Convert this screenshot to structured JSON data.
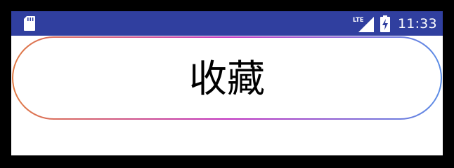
{
  "status_bar": {
    "background": "#303F9F",
    "network_label": "LTE",
    "time": "11:33",
    "icons": [
      "sd-card-icon",
      "lte-signal-icon",
      "battery-charging-icon"
    ]
  },
  "main": {
    "favorite_button_label": "收藏",
    "button_gradient": [
      "#E07B45",
      "#C02FBF",
      "#5B8EE6"
    ]
  }
}
